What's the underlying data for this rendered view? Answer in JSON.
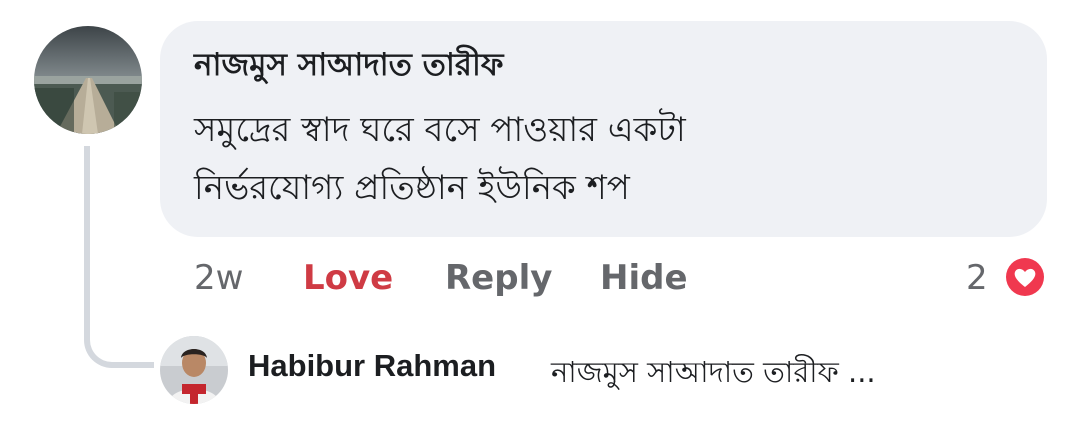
{
  "comment": {
    "author": "নাজমুস সাআদাত তারীফ",
    "lines": [
      "সমুদ্রের স্বাদ ঘরে বসে পাওয়ার একটা",
      "নির্ভরযোগ্য প্রতিষ্ঠান ইউনিক শপ"
    ],
    "avatar_icon": "pier-sea-photo-avatar"
  },
  "actions": {
    "time": "2w",
    "love": "Love",
    "reply": "Reply",
    "hide": "Hide"
  },
  "reactions": {
    "count": "2",
    "icon": "love-heart-icon",
    "color": "#f0384f"
  },
  "reply_preview": {
    "author": "Habibur Rahman",
    "text": "নাজমুস সাআদাত তারীফ ...",
    "avatar_icon": "person-photo-avatar"
  },
  "colors": {
    "bubble": "#eff1f5",
    "love_active": "#cf3b44",
    "muted": "#65676b",
    "thread_line": "#d4d8de"
  }
}
